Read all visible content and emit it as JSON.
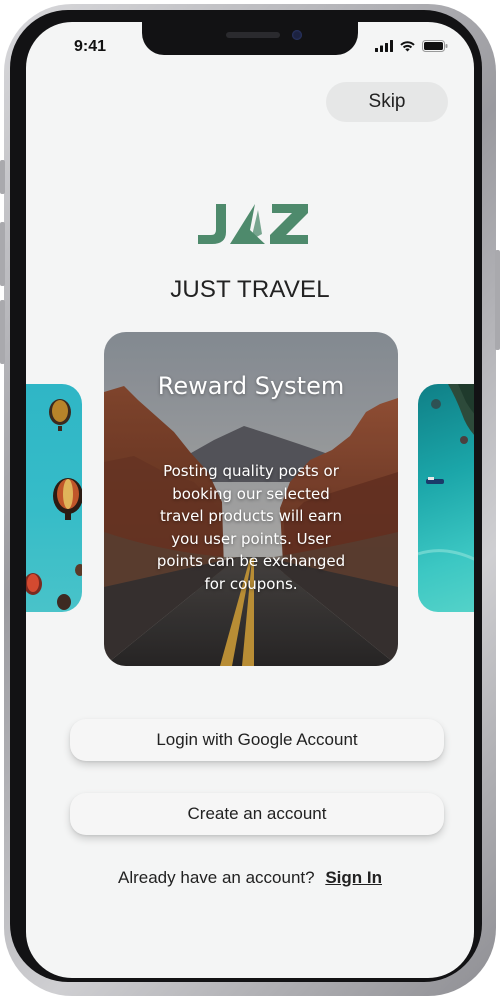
{
  "status_bar": {
    "time": "9:41"
  },
  "header": {
    "skip_label": "Skip"
  },
  "brand": {
    "logo_text": "JAZ",
    "tagline": "JUST TRAVEL",
    "logo_color": "#4e8a6c"
  },
  "carousel": {
    "current": {
      "title": "Reward System",
      "description": "Posting quality posts or booking our selected travel products will earn you user points. User points can be exchanged for coupons."
    }
  },
  "actions": {
    "google_login_label": "Login with Google Account",
    "create_account_label": "Create an account"
  },
  "signin": {
    "prompt": "Already have an account?",
    "link_label": "Sign In"
  }
}
